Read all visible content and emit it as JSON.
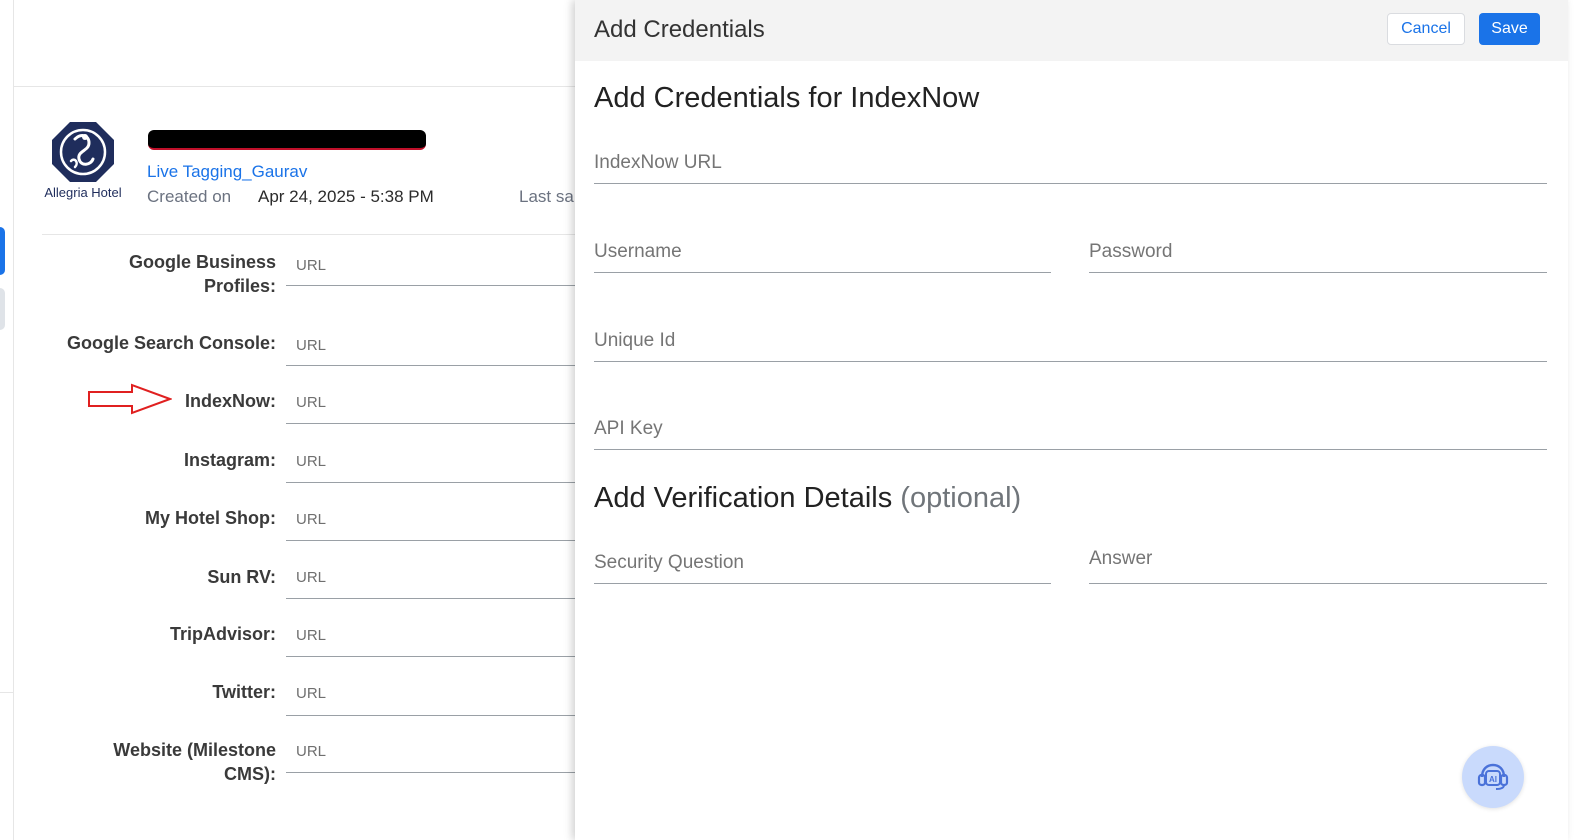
{
  "background": {
    "logo": {
      "text": "Allegria Hotel"
    },
    "hotel_tag": "Live Tagging_Gaurav",
    "created_label": "Created on",
    "created_value": "Apr 24, 2025 - 5:38 PM",
    "last_saved_label": "Last sa",
    "fields": [
      {
        "label": "Google Business Profiles:",
        "label_line1": "Google Business",
        "label_line2": "Profiles:",
        "placeholder": "URL"
      },
      {
        "label": "Google Search Console:",
        "placeholder": "URL"
      },
      {
        "label": "IndexNow:",
        "placeholder": "URL"
      },
      {
        "label": "Instagram:",
        "placeholder": "URL"
      },
      {
        "label": "My Hotel Shop:",
        "placeholder": "URL"
      },
      {
        "label": "Sun RV:",
        "placeholder": "URL"
      },
      {
        "label": "TripAdvisor:",
        "placeholder": "URL"
      },
      {
        "label": "Twitter:",
        "placeholder": "URL"
      },
      {
        "label": "Website (Milestone CMS):",
        "label_line1": "Website (Milestone",
        "label_line2": "CMS):",
        "placeholder": "URL"
      }
    ]
  },
  "panel": {
    "title": "Add Credentials",
    "cancel_label": "Cancel",
    "save_label": "Save",
    "section1_title": "Add Credentials for IndexNow",
    "fields": {
      "indexnow_url": "IndexNow URL",
      "username": "Username",
      "password": "Password",
      "unique_id": "Unique Id",
      "api_key": "API Key",
      "security_question": "Security Question",
      "answer": "Answer"
    },
    "section2_title": "Add Verification Details",
    "section2_optional": "(optional)",
    "ai_button_icon": "ai-headset-icon"
  },
  "colors": {
    "accent": "#1a73e8",
    "annotation_arrow": "#e02020",
    "ai_button_bg": "#c9dafc"
  }
}
